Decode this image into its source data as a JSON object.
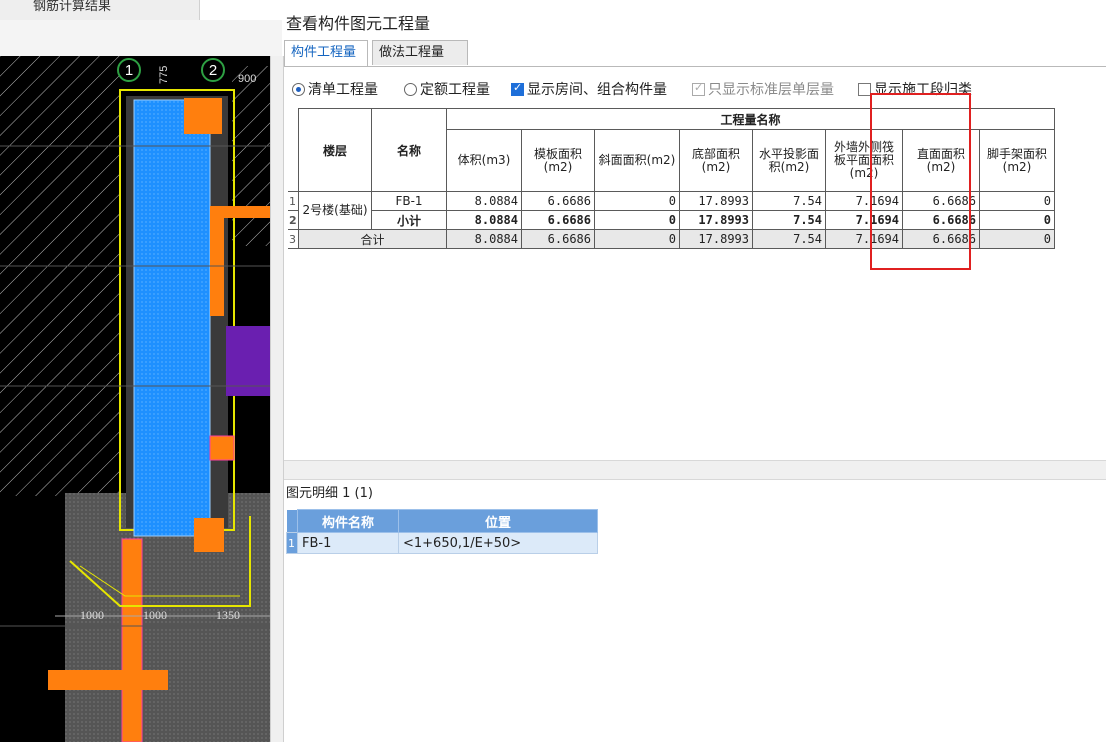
{
  "top_tab": "钢筋计算结果",
  "cad": {
    "axis_labels": [
      "1",
      "2"
    ],
    "top_dims": [
      "775",
      "900"
    ],
    "bottom_dims": [
      "1000",
      "1000",
      "1350"
    ]
  },
  "panel": {
    "title": "查看构件图元工程量",
    "tabs": [
      "构件工程量",
      "做法工程量"
    ],
    "options": {
      "bill_qty": "清单工程量",
      "quota_qty": "定额工程量",
      "show_room": "显示房间、组合构件量",
      "std_floor_only": "只显示标准层单层量",
      "show_stage": "显示施工段归类"
    },
    "table": {
      "col_floor": "楼层",
      "col_name": "名称",
      "group_header": "工程量名称",
      "columns": [
        "体积(m3)",
        "模板面积(m2)",
        "斜面面积(m2)",
        "底部面积(m2)",
        "水平投影面积(m2)",
        "外墙外侧筏板平面面积(m2)",
        "直面面积(m2)",
        "脚手架面积(m2)"
      ],
      "floor_value": "2号楼(基础)",
      "rows": [
        {
          "num": "1",
          "name": "FB-1",
          "values": [
            "8.0884",
            "6.6686",
            "0",
            "17.8993",
            "7.54",
            "7.1694",
            "6.6686",
            "0"
          ]
        },
        {
          "num": "2",
          "name": "小计",
          "values": [
            "8.0884",
            "6.6686",
            "0",
            "17.8993",
            "7.54",
            "7.1694",
            "6.6686",
            "0"
          ]
        }
      ],
      "total": {
        "num": "3",
        "label": "合计",
        "values": [
          "8.0884",
          "6.6686",
          "0",
          "17.8993",
          "7.54",
          "7.1694",
          "6.6686",
          "0"
        ]
      }
    },
    "detail": {
      "title": "图元明细  1 (1)",
      "headers": [
        "构件名称",
        "位置"
      ],
      "row": {
        "num": "1",
        "name": "FB-1",
        "position": "<1+650,1/E+50>"
      }
    }
  },
  "colors": {
    "accent_tab": "#1565c0",
    "highlight_box": "#e02020",
    "detail_header": "#6a9fdc",
    "cad_slab": "#1e90ff",
    "cad_beam": "#ff7f0e"
  }
}
